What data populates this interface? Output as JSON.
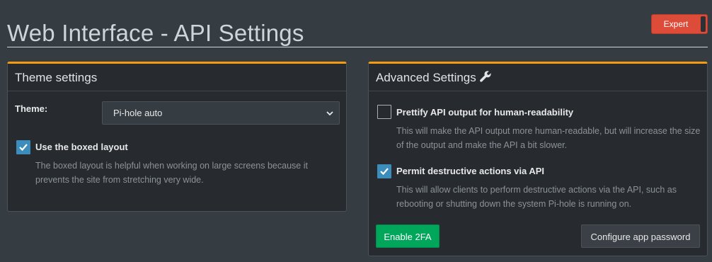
{
  "page": {
    "title": "Web Interface - API Settings"
  },
  "expert_toggle": {
    "label": "Expert",
    "state": "on",
    "color": "#dd4b39"
  },
  "theme_box": {
    "title": "Theme settings",
    "theme_label": "Theme:",
    "theme_select_value": "Pi-hole auto",
    "boxed_layout": {
      "label": "Use the boxed layout",
      "checked": true,
      "description": "The boxed layout is helpful when working on large screens because it prevents the site from stretching very wide."
    }
  },
  "advanced_box": {
    "title": "Advanced Settings",
    "title_icon": "wrench-icon",
    "prettify": {
      "label": "Prettify API output for human-readability",
      "checked": false,
      "description": "This will make the API output more human-readable, but will increase the size of the output and make the API a bit slower."
    },
    "destructive": {
      "label": "Permit destructive actions via API",
      "checked": true,
      "description": "This will allow clients to perform destructive actions via the API, such as rebooting or shutting down the system Pi-hole is running on."
    },
    "enable_2fa_label": "Enable 2FA",
    "configure_app_password_label": "Configure app password"
  },
  "colors": {
    "accent_orange": "#f39c12",
    "checkbox_blue": "#3c8dbc",
    "success_green": "#00a65a",
    "danger_red": "#dd4b39"
  }
}
